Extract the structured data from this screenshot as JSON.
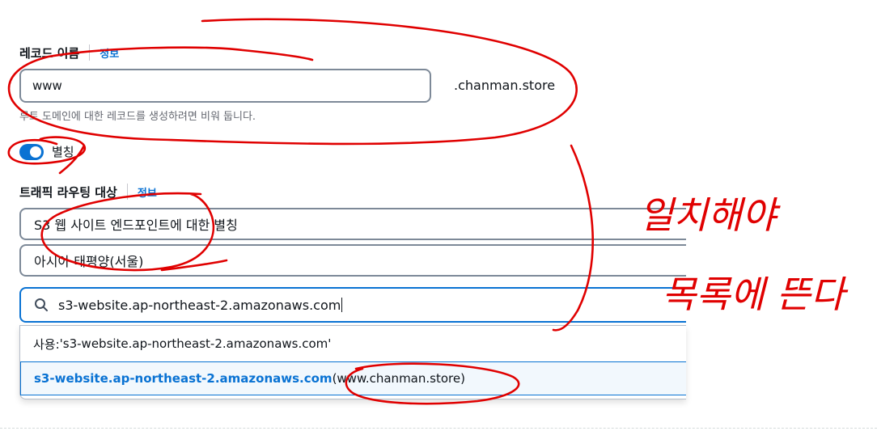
{
  "record_name": {
    "label": "레코드 이름",
    "info": "정보",
    "value": "www",
    "domain_suffix": ".chanman.store",
    "hint": "루트 도메인에 대한 레코드를 생성하려면 비워 둡니다."
  },
  "alias": {
    "label": "별칭",
    "enabled": true
  },
  "traffic_target": {
    "label": "트래픽 라우팅 대상",
    "info": "정보",
    "endpoint_type": "S3 웹 사이트 엔드포인트에 대한 별칭",
    "region": "아시아 태평양(서울)",
    "search_value": "s3-website.ap-northeast-2.amazonaws.com",
    "options": [
      {
        "prefix": "사용: ",
        "text": "'s3-website.ap-northeast-2.amazonaws.com'"
      },
      {
        "endpoint": "s3-website.ap-northeast-2.amazonaws.com",
        "detail": " (www.chanman.store)"
      }
    ]
  },
  "handwritten_note": {
    "line1": "일치해야",
    "line2": "목록에 뜬다"
  },
  "colors": {
    "accent": "#0972d3",
    "annotation": "#e00000",
    "border": "#7d8998"
  }
}
